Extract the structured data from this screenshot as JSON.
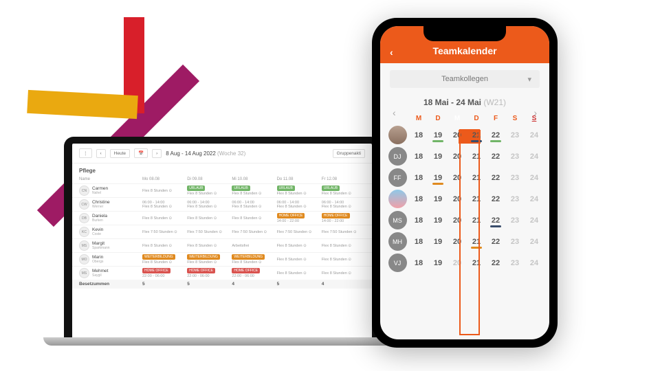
{
  "laptop": {
    "today_btn": "Heute",
    "range": "8 Aug - 14 Aug 2022",
    "week": "(Woche 32)",
    "group_btn": "Gruppenakti",
    "section": "Pflege",
    "name_col": "Name",
    "days": [
      "Mo 08.08",
      "Di 09.08",
      "Mi 10.08",
      "Do 11.08",
      "Fr 12.08"
    ],
    "flex": "Flex 8 Stunden",
    "flex750": "Flex 7:50 Stunden",
    "time": "06:00 - 14:00",
    "time2": "14:00 - 22:00",
    "time3": "22:00 - 06:00",
    "urlaub": "URLAUB",
    "home": "HOME OFFICE",
    "weiter": "WEITERBILDUNG",
    "arbeitsfrei": "Arbeitsfrei",
    "people": [
      {
        "i": "CN",
        "n": "Carmen",
        "s": "Nahel"
      },
      {
        "i": "CW",
        "n": "Christine",
        "s": "Werner"
      },
      {
        "i": "DB",
        "n": "Daniela",
        "s": "Burken"
      },
      {
        "i": "KC",
        "n": "Kevin",
        "s": "Coste"
      },
      {
        "i": "MS",
        "n": "Margit",
        "s": "Sparkmann"
      },
      {
        "i": "MO",
        "n": "Marin",
        "s": "Obergs"
      },
      {
        "i": "MS",
        "n": "Mehmet",
        "s": "Saygil"
      }
    ],
    "sum_label": "Besetzummen",
    "sums": [
      "5",
      "5",
      "4",
      "5",
      "4"
    ]
  },
  "phone": {
    "title": "Teamkalender",
    "dropdown": "Teamkollegen",
    "range": "18 Mai - 24 Mai",
    "week": "(W21)",
    "days": [
      "M",
      "D",
      "M",
      "D",
      "F",
      "S",
      "S"
    ],
    "dates": [
      "18",
      "19",
      "20",
      "21",
      "22",
      "23",
      "24"
    ],
    "rows": [
      "",
      "DJ",
      "FF",
      "",
      "MS",
      "MH",
      "VJ"
    ]
  }
}
